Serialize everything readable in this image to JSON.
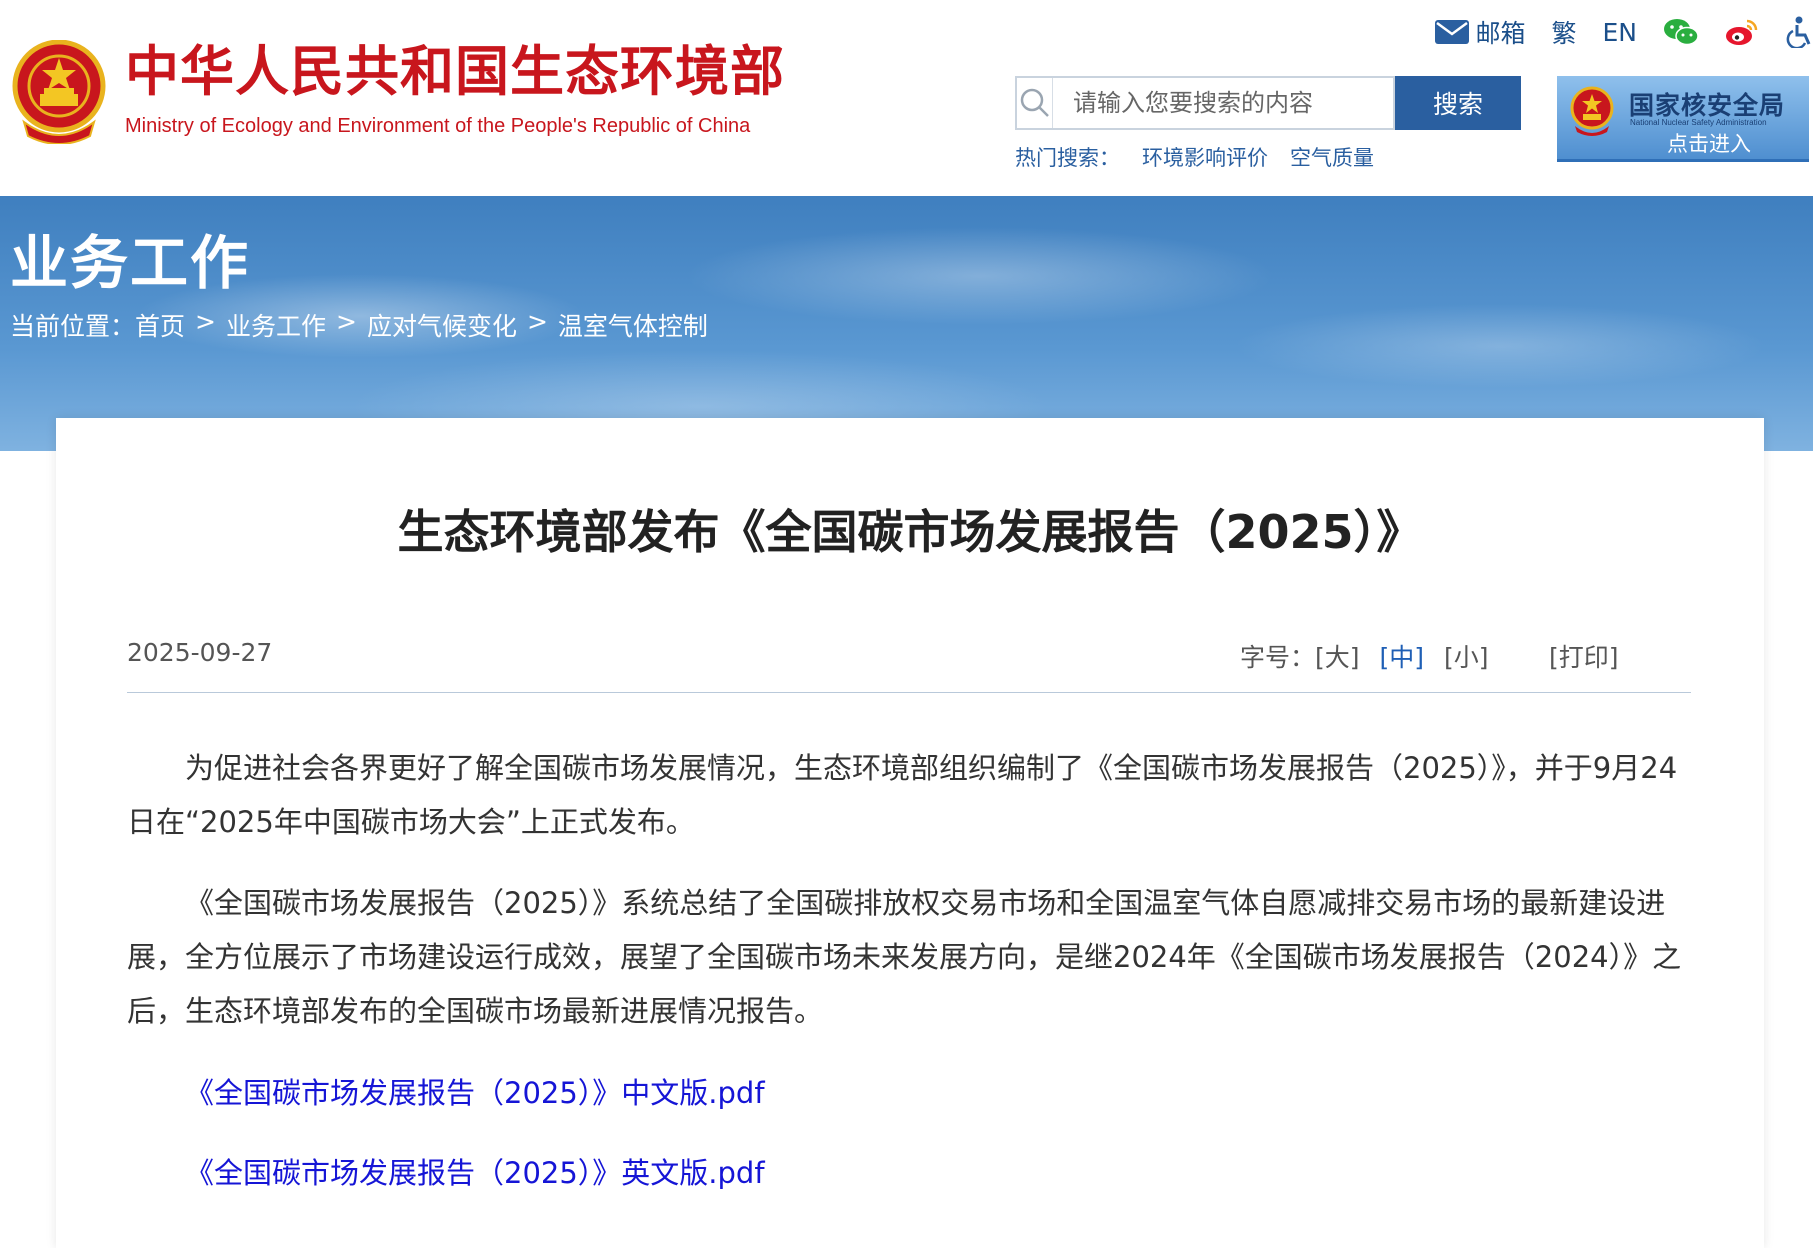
{
  "header": {
    "logo_cn": "中华人民共和国生态环境部",
    "logo_en": "Ministry of Ecology and Environment of the People's Republic of China",
    "links": {
      "mail": "邮箱",
      "traditional": "繁",
      "english": "EN"
    },
    "search": {
      "placeholder": "请输入您要搜索的内容",
      "button": "搜索",
      "hot_label": "热门搜索：",
      "hot_keywords": [
        "环境影响评价",
        "空气质量"
      ]
    },
    "nnsa": {
      "title": "国家核安全局",
      "subtitle": "National Nuclear Safety Administration",
      "enter": "点击进入"
    }
  },
  "banner": {
    "title": "业务工作",
    "breadcrumb_label": "当前位置：",
    "breadcrumb": [
      "首页",
      "业务工作",
      "应对气候变化",
      "温室气体控制"
    ],
    "separator": ">"
  },
  "article": {
    "title": "生态环境部发布《全国碳市场发展报告（2025）》",
    "date": "2025-09-27",
    "font_label": "字号：",
    "font_options": [
      "[大]",
      "[中]",
      "[小]"
    ],
    "print": "[打印]",
    "paragraphs": [
      "为促进社会各界更好了解全国碳市场发展情况，生态环境部组织编制了《全国碳市场发展报告（2025）》，并于9月24日在“2025年中国碳市场大会”上正式发布。",
      "《全国碳市场发展报告（2025）》系统总结了全国碳排放权交易市场和全国温室气体自愿减排交易市场的最新建设进展，全方位展示了市场建设运行成效，展望了全国碳市场未来发展方向，是继2024年《全国碳市场发展报告（2024）》之后，生态环境部发布的全国碳市场最新进展情况报告。"
    ],
    "attachments": [
      "《全国碳市场发展报告（2025）》中文版.pdf",
      "《全国碳市场发展报告（2025）》英文版.pdf"
    ]
  },
  "colors": {
    "brand_red": "#c8161d",
    "link_blue": "#1515d6",
    "header_blue": "#2a5fa0"
  }
}
